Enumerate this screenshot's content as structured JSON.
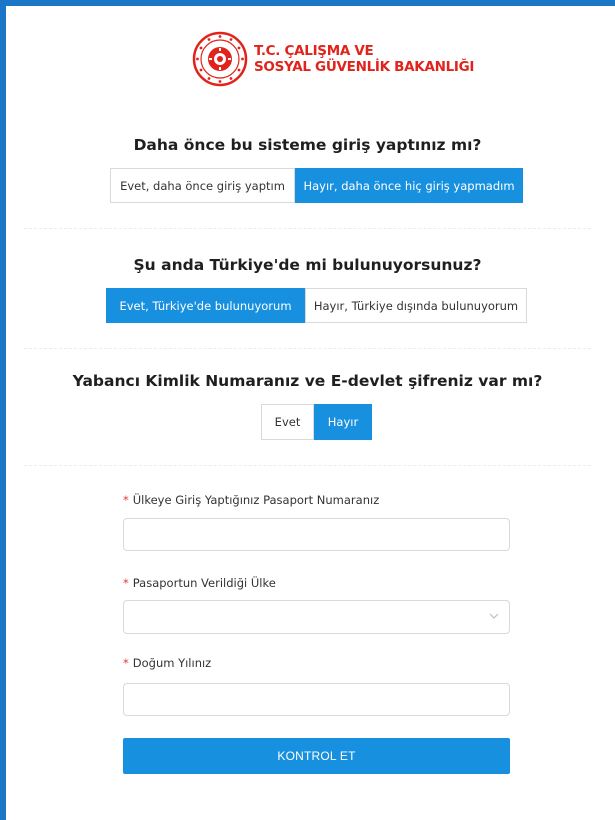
{
  "header": {
    "logo_line1": "T.C. ÇALIŞMA VE",
    "logo_line2": "SOSYAL GÜVENLİK BAKANLIĞI",
    "logo_icon": "ministry-seal-icon"
  },
  "q1": {
    "question": "Daha önce bu sisteme giriş yaptınız mı?",
    "options": [
      "Evet, daha önce giriş yaptım",
      "Hayır, daha önce hiç giriş yapmadım"
    ],
    "selected": 1
  },
  "q2": {
    "question": "Şu anda Türkiye'de mi bulunuyorsunuz?",
    "options": [
      "Evet, Türkiye'de bulunuyorum",
      "Hayır, Türkiye dışında bulunuyorum"
    ],
    "selected": 0
  },
  "q3": {
    "question": "Yabancı Kimlik Numaranız ve E-devlet şifreniz var mı?",
    "options": [
      "Evet",
      "Hayır"
    ],
    "selected": 1
  },
  "form": {
    "required_mark": "*",
    "passport_label": "Ülkeye Giriş Yaptığınız Pasaport Numaranız",
    "passport_value": "",
    "country_label": "Pasaportun Verildiği Ülke",
    "country_value": "",
    "birth_label": "Doğum Yılınız",
    "birth_value": "",
    "submit_label": "KONTROL ET"
  },
  "colors": {
    "accent": "#1890e0",
    "frame": "#1b76c8",
    "brand_red": "#e0241b",
    "required": "#e53935"
  }
}
